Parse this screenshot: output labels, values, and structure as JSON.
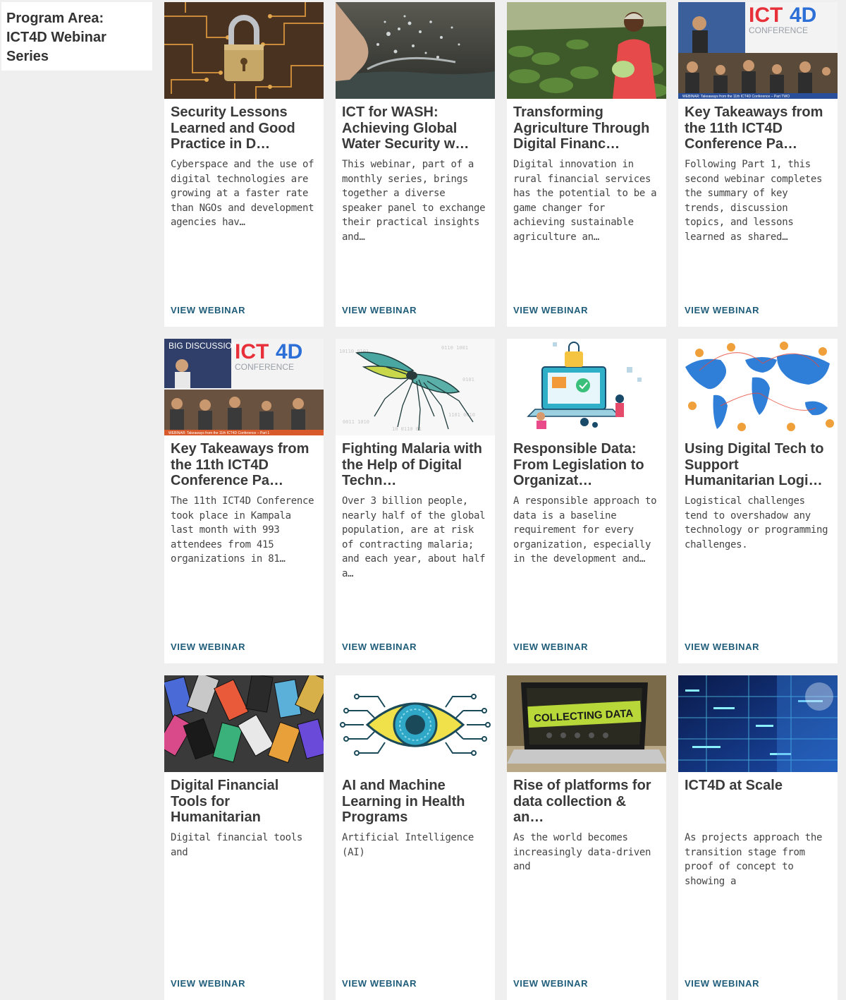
{
  "sidebar": {
    "title_line1": "Program Area:",
    "title_line2": "ICT4D Webinar",
    "title_line3": "Series"
  },
  "cards": [
    {
      "image": "padlock-circuit-board",
      "title": "Security Lessons Learned and Good Practice in D…",
      "description": "Cyberspace and the use of digital technologies are growing at a faster rate than NGOs and development agencies hav…",
      "link": "VIEW WEBINAR"
    },
    {
      "image": "hand-water-splash",
      "title": "ICT for WASH: Achieving Global Water Security w…",
      "description": "This webinar, part of a monthly series, brings together a diverse speaker panel to exchange their practical insights and…",
      "link": "VIEW WEBINAR"
    },
    {
      "image": "farmer-field",
      "title": "Transforming Agriculture Through Digital Financ…",
      "description": "Digital innovation in rural financial services has the potential to be a game changer for achieving sustainable agriculture an…",
      "link": "VIEW WEBINAR"
    },
    {
      "image": "conference-collage",
      "title": "Key Takeaways from the 11th ICT4D Conference Pa…",
      "description": "Following Part 1, this second webinar completes the summary of key trends, discussion topics, and lessons learned as shared…",
      "link": "VIEW WEBINAR"
    },
    {
      "image": "conference-collage",
      "title": "Key Takeaways from the 11th ICT4D Conference Pa…",
      "description": "The 11th ICT4D Conference took place in Kampala last month with 993 attendees from 415 organizations in 81…",
      "link": "VIEW WEBINAR"
    },
    {
      "image": "mosquito-digital",
      "title": "Fighting Malaria with the Help of Digital Techn…",
      "description": "Over 3 billion people, nearly half of the global population, are at risk of contracting malaria; and each year, about half a…",
      "link": "VIEW WEBINAR"
    },
    {
      "image": "data-illustration",
      "title": "Responsible Data: From Legislation to Organizat…",
      "description": "A responsible approach to data is a baseline requirement for every organization, especially in the development and…",
      "link": "VIEW WEBINAR"
    },
    {
      "image": "world-map-network",
      "title": "Using Digital Tech to Support Humanitarian Logi…",
      "description": "Logistical challenges tend to overshadow any technology or programming challenges.",
      "link": "VIEW WEBINAR"
    },
    {
      "image": "pile-of-phones",
      "title": "Digital Financial Tools for Humanitarian Response",
      "description": "Digital financial tools and",
      "link": "VIEW WEBINAR"
    },
    {
      "image": "circuit-eye",
      "title": "AI and Machine Learning in Health Programs",
      "description": "Artificial Intelligence (AI)",
      "link": "VIEW WEBINAR"
    },
    {
      "image": "laptop-collecting-data",
      "title": "Rise of platforms for data collection & an…",
      "description": "As the world becomes increasingly data-driven and",
      "link": "VIEW WEBINAR"
    },
    {
      "image": "server-lights",
      "title": "ICT4D at Scale",
      "description": "As projects approach the transition stage from proof of concept to showing a",
      "link": "VIEW WEBINAR"
    }
  ],
  "image_text": {
    "collage_ict": "ICT",
    "collage_4d": "4D",
    "collage_conference": "CONFERENCE",
    "collage_banner_2": "WEBINAR: Takeaways from the 11th ICT4D Conference – Part TWO",
    "collage_banner_1": "WEBINAR: Takeaways from the 11th ICT4D Conference – Part 1",
    "big_discussion": "BIG DISCUSSION",
    "collecting_data": "COLLECTING DATA"
  },
  "colors": {
    "link": "#1f5d7a",
    "background": "#efefef",
    "card": "#ffffff",
    "ict_red": "#e8303a",
    "ict_blue": "#2c6fd6"
  }
}
